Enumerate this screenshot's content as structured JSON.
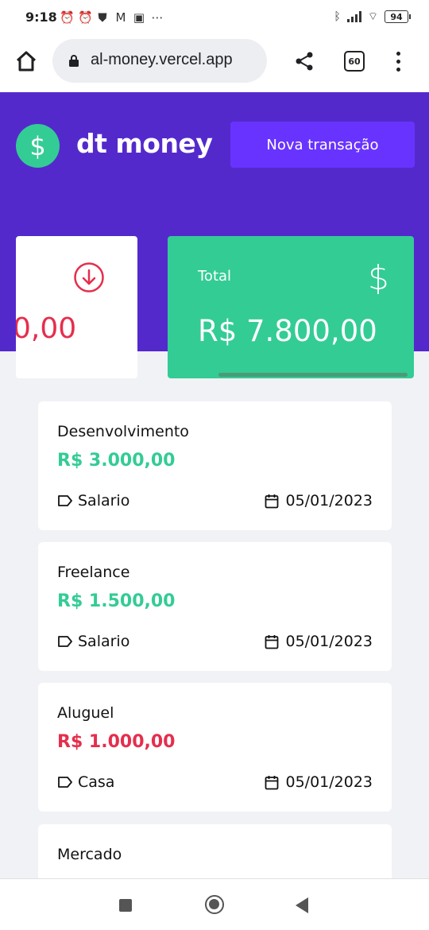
{
  "status_bar": {
    "time": "9:18",
    "battery": "94"
  },
  "browser": {
    "url": "al-money.vercel.app",
    "tab_count": "60"
  },
  "header": {
    "logo_text": "dt money",
    "new_transaction_label": "Nova transação"
  },
  "summary": {
    "outcome_value_partial": "0,00",
    "total_label": "Total",
    "total_value": "R$ 7.800,00"
  },
  "transactions": [
    {
      "description": "Desenvolvimento",
      "amount": "R$ 3.000,00",
      "type": "income",
      "category": "Salario",
      "date": "05/01/2023"
    },
    {
      "description": "Freelance",
      "amount": "R$ 1.500,00",
      "type": "income",
      "category": "Salario",
      "date": "05/01/2023"
    },
    {
      "description": "Aluguel",
      "amount": "R$ 1.000,00",
      "type": "outcome",
      "category": "Casa",
      "date": "05/01/2023"
    },
    {
      "description": "Mercado",
      "amount": "",
      "type": "outcome",
      "category": "",
      "date": ""
    }
  ],
  "colors": {
    "purple": "#5429cc",
    "button": "#6933ff",
    "green": "#33cc95",
    "red": "#e52e4d",
    "background": "#f0f2f5"
  },
  "icons": [
    "tag-icon",
    "calendar-icon",
    "dollar-icon",
    "arrow-down-circle-icon",
    "home-icon",
    "lock-icon",
    "share-icon",
    "more-vert-icon"
  ]
}
